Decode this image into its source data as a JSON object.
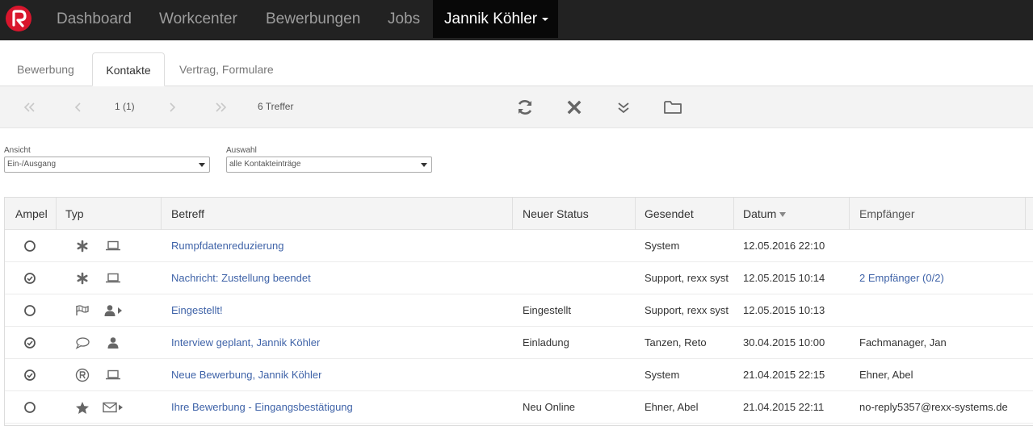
{
  "nav": {
    "items": [
      "Dashboard",
      "Workcenter",
      "Bewerbungen",
      "Jobs"
    ],
    "user": "Jannik Köhler"
  },
  "tabs": [
    "Bewerbung",
    "Kontakte",
    "Vertrag, Formulare"
  ],
  "active_tab": "Kontakte",
  "toolbar": {
    "page": "1 (1)",
    "hits": "6 Treffer"
  },
  "filters": {
    "view_label": "Ansicht",
    "view_value": "Ein-/Ausgang",
    "selection_label": "Auswahl",
    "selection_value": "alle Kontakteinträge"
  },
  "table": {
    "columns": [
      "Ampel",
      "Typ",
      "Betreff",
      "Neuer Status",
      "Gesendet",
      "Datum",
      "Empfänger"
    ],
    "rows": [
      {
        "ampel": "empty",
        "icons": [
          "asterisk-icon",
          "laptop-icon"
        ],
        "betreff": "Rumpfdatenreduzierung",
        "status": "",
        "gesendet": "System",
        "datum": "12.05.2016 22:10",
        "empfaenger": "",
        "empfaenger_link": false
      },
      {
        "ampel": "check",
        "icons": [
          "asterisk-icon",
          "laptop-icon"
        ],
        "betreff": "Nachricht: Zustellung beendet",
        "status": "",
        "gesendet": "Support, rexx syst",
        "datum": "12.05.2015 10:14",
        "empfaenger": "2 Empfänger (0/2)",
        "empfaenger_link": true
      },
      {
        "ampel": "empty",
        "icons": [
          "flag-icon",
          "user-send-icon"
        ],
        "betreff": "Eingestellt!",
        "status": "Eingestellt",
        "gesendet": "Support, rexx syst",
        "datum": "12.05.2015 10:13",
        "empfaenger": "",
        "empfaenger_link": false
      },
      {
        "ampel": "check",
        "icons": [
          "speech-bubble-icon",
          "user-icon"
        ],
        "betreff": "Interview geplant, Jannik Köhler",
        "status": "Einladung",
        "gesendet": "Tanzen, Reto",
        "datum": "30.04.2015 10:00",
        "empfaenger": "Fachmanager, Jan",
        "empfaenger_link": false
      },
      {
        "ampel": "check",
        "icons": [
          "registered-icon",
          "laptop-icon"
        ],
        "betreff": "Neue Bewerbung, Jannik Köhler",
        "status": "",
        "gesendet": "System",
        "datum": "21.04.2015 22:15",
        "empfaenger": "Ehner, Abel",
        "empfaenger_link": false
      },
      {
        "ampel": "empty",
        "icons": [
          "star-icon",
          "envelope-send-icon"
        ],
        "betreff": "Ihre Bewerbung - Eingangsbestätigung",
        "status": "Neu Online",
        "gesendet": "Ehner, Abel",
        "datum": "21.04.2015 22:11",
        "empfaenger": "no-reply5357@rexx-systems.de",
        "empfaenger_link": false
      }
    ]
  },
  "colors": {
    "nav_bg": "#222222",
    "link": "#3f63a8",
    "brand": "#d9162d"
  }
}
